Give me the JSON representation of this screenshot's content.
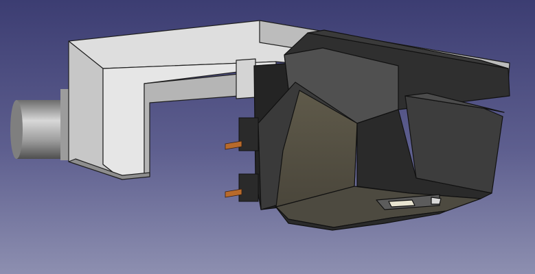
{
  "viewport": {
    "background_top": "#3c3d72",
    "background_bottom": "#8d8fb0"
  },
  "model": {
    "icon": "3d-cartridge-model",
    "colors": {
      "headshell_light": "#dcdcdc",
      "headshell_mid": "#b9b9b9",
      "headshell_dark": "#8e8e8e",
      "body_dark": "#2b2b2b",
      "body_mid": "#4a4a4a",
      "body_olive": "#5a5648",
      "pin_copper": "#b86a2b"
    }
  }
}
